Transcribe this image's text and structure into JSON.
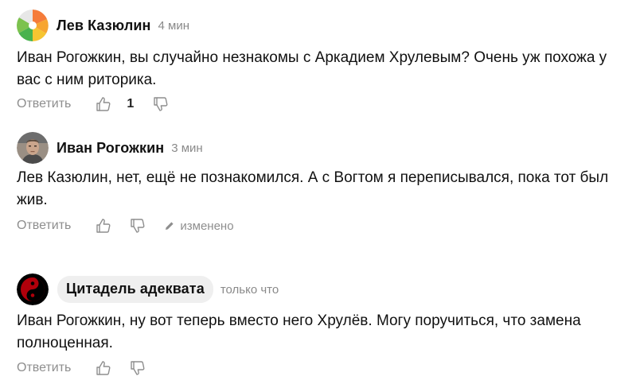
{
  "comments": [
    {
      "author": "Лев Казюлин",
      "time": "4 мин",
      "text": "Иван Рогожкин, вы случайно незнакомы с Аркадием Хрулевым? Очень уж похожа у вас с ним риторика.",
      "reply_label": "Ответить",
      "likes": "1",
      "avatar_icon": "colorful-circle-avatar"
    },
    {
      "author": "Иван Рогожкин",
      "time": "3 мин",
      "text": "Лев Казюлин, нет, ещё не познакомился. А с Вогтом я переписывался, пока тот был жив.",
      "reply_label": "Ответить",
      "edited_label": "изменено",
      "avatar_icon": "user-photo-avatar"
    },
    {
      "author": "Цитадель адеквата",
      "time": "только что",
      "text": "Иван Рогожкин, ну вот теперь вместо него Хрулёв. Могу поручиться, что замена полноценная.",
      "reply_label": "Ответить",
      "avatar_icon": "yin-yang-avatar"
    }
  ],
  "colors": {
    "muted": "#8e8e8e",
    "text": "#111111",
    "pill_bg": "#efefef"
  }
}
